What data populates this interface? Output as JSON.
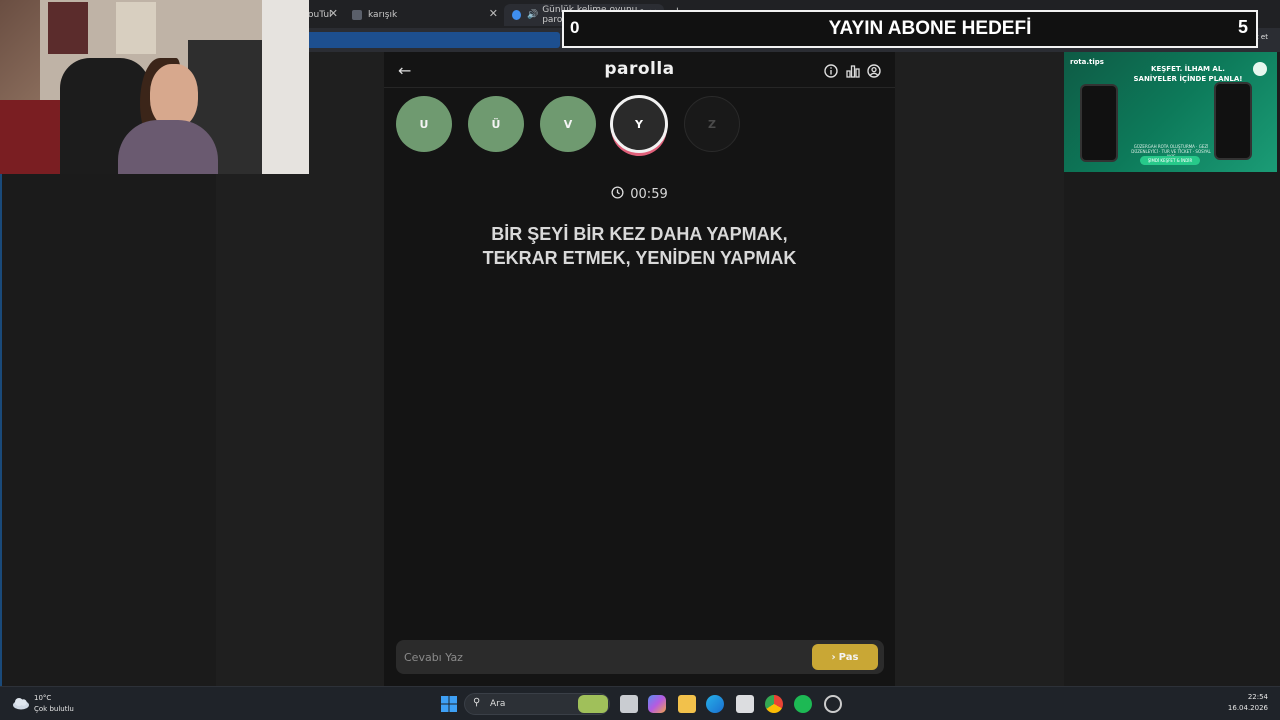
{
  "browser": {
    "tabs": [
      {
        "label": "ouTul",
        "active": false
      },
      {
        "label": "karışık",
        "active": false
      },
      {
        "label": "Günlük kelime oyunu - parol",
        "active": true
      }
    ],
    "new_tab": "+",
    "chat_label": "Sohbet et"
  },
  "overlay": {
    "left_count": "0",
    "title": "YAYIN ABONE HEDEFİ",
    "right_count": "5"
  },
  "app": {
    "brand": "parolla",
    "letters": [
      {
        "char": "U",
        "state": "done"
      },
      {
        "char": "Ü",
        "state": "done"
      },
      {
        "char": "V",
        "state": "done"
      },
      {
        "char": "Y",
        "state": "current"
      },
      {
        "char": "Z",
        "state": "pending"
      }
    ],
    "timer": "00:59",
    "question_line1": "BİR ŞEYİ BİR KEZ DAHA YAPMAK,",
    "question_line2": "TEKRAR ETMEK, YENİDEN YAPMAK",
    "answer_placeholder": "Cevabı Yaz",
    "pass_label": "Pas",
    "accent": "#c9a735",
    "done_color": "#6f9a70"
  },
  "ad": {
    "logo": "rota.tips",
    "headline_line1": "KEŞFET. İLHAM AL.",
    "headline_line2": "SANİYELER İÇİNDE PLANLA!",
    "body": "GÜZERGAH ROTA OLUŞTURMA · GEZİ DÜZENLEYİCİ · TUR VE TİCKET · SOSYAL AKIŞ",
    "cta": "ŞİMDİ KEŞFET & İNDİR"
  },
  "taskbar": {
    "temperature": "10°C",
    "weather": "Çok bulutlu",
    "search_label": "Ara",
    "time": "22:54",
    "date": "16.04.2026"
  }
}
